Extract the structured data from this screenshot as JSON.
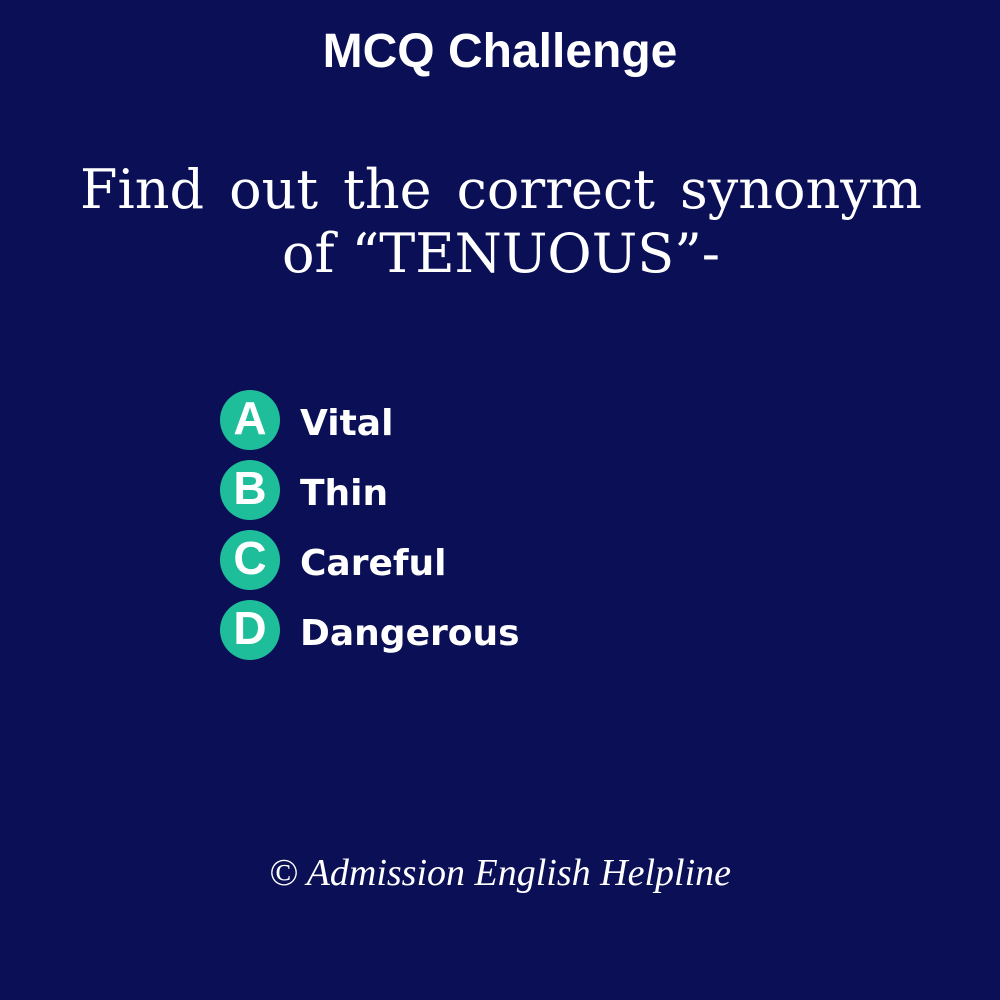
{
  "title": "MCQ Challenge",
  "question": "Find out the correct synonym of “TENUOUS”-",
  "options": [
    {
      "letter": "A",
      "text": "Vital"
    },
    {
      "letter": "B",
      "text": "Thin"
    },
    {
      "letter": "C",
      "text": "Careful"
    },
    {
      "letter": "D",
      "text": "Dangerous"
    }
  ],
  "footer": "© Admission English Helpline",
  "colors": {
    "background": "#0a0f56",
    "badge": "#1fbe9a",
    "text": "#ffffff"
  }
}
